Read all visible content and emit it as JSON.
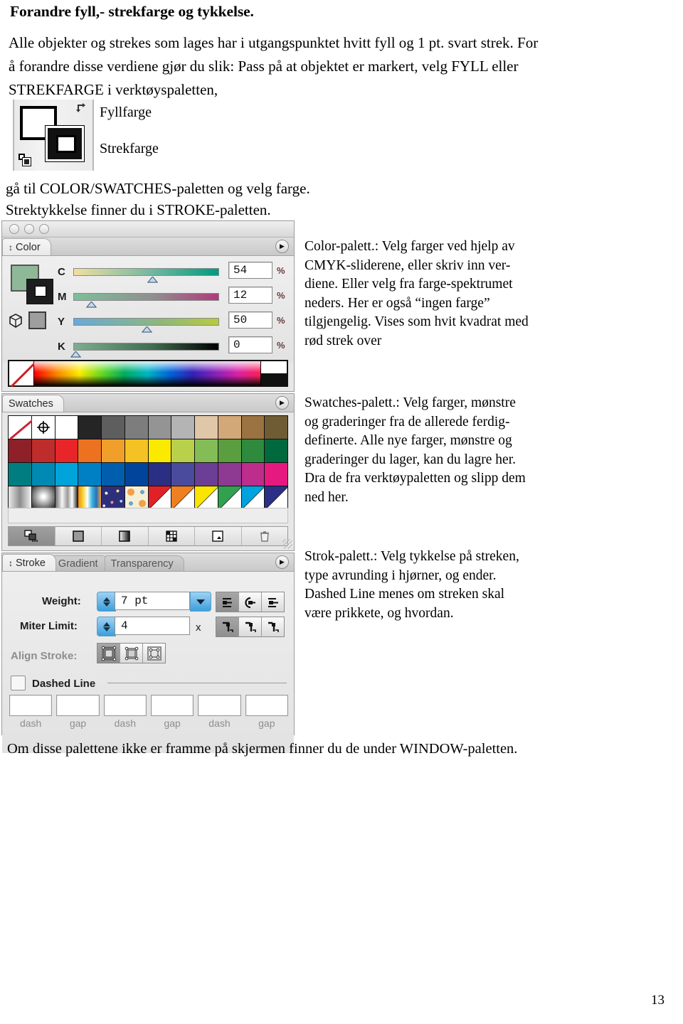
{
  "document": {
    "title": "Forandre fyll,- strekfarge og tykkelse.",
    "intro_lines": [
      "Alle objekter og strekes som lages har i utgangspunktet hvitt fyll og 1 pt. svart strek. For",
      "å forandre disse verdiene gjør du slik: Pass på at objektet er markert, velg FYLL eller",
      "STREKFARGE i verktøyspaletten,"
    ],
    "fill_label": "Fyllfarge",
    "stroke_label": "Strekfarge",
    "palette_lines": [
      "gå til COLOR/SWATCHES-paletten og velg farge.",
      "Strektykkelse finner du i STROKE-paletten."
    ],
    "bottom_note": "Om disse palettene ikke er framme på skjermen finner du de under WINDOW-paletten.",
    "page_number": "13"
  },
  "callouts": {
    "color": [
      "Color-palett.: Velg farger ved hjelp av",
      "CMYK-sliderene, eller skriv inn ver-",
      "diene. Eller velg fra farge-spektrumet",
      "neders. Her er også “ingen farge”",
      "tilgjengelig. Vises som hvit kvadrat med",
      "rød strek over"
    ],
    "swatches": [
      "Swatches-palett.: Velg farger, mønstre",
      "og graderinger fra de allerede ferdig-",
      "definerte. Alle nye farger, mønstre og",
      "graderinger du lager, kan du lagre her.",
      "Dra de fra verktøypaletten og slipp dem",
      "ned her."
    ],
    "stroke": [
      "Strok-palett.: Velg tykkelse på streken,",
      "type avrunding i hjørner, og ender.",
      "Dashed Line menes om streken skal",
      "være prikkete, og hvordan."
    ]
  },
  "color_panel": {
    "tab_label": "Color",
    "fill_color": "#8fb899",
    "stroke_color": "#1d1d1d",
    "channels": [
      {
        "name": "C",
        "value": "54",
        "unit": "%",
        "percent": 54
      },
      {
        "name": "M",
        "value": "12",
        "unit": "%",
        "percent": 12
      },
      {
        "name": "Y",
        "value": "50",
        "unit": "%",
        "percent": 50
      },
      {
        "name": "K",
        "value": "0",
        "unit": "%",
        "percent": 0
      }
    ]
  },
  "swatches_panel": {
    "tab_label": "Swatches",
    "rows": [
      [
        "none",
        "registration",
        "#ffffff",
        "#252525",
        "#5e5e5e",
        "#7d7d7d",
        "#949494",
        "#b4b4b4",
        "#e0c7a8",
        "#d2a878",
        "#9a7340",
        "#6f5c35"
      ],
      [
        "#8d2028",
        "#bf2c2c",
        "#e8262a",
        "#ed7220",
        "#f0a02a",
        "#f4c222",
        "#fbe900",
        "#b9d04a",
        "#84bd55",
        "#5a9e3f",
        "#2e8b3d",
        "#00693e"
      ],
      [
        "#007d81",
        "#0089b3",
        "#00a3da",
        "#0080c4",
        "#005ead",
        "#00459b",
        "#2a2f83",
        "#4b4b9e",
        "#6b3f96",
        "#8e3a92",
        "#bd2d8c",
        "#e6197f"
      ],
      [
        "grad-gray",
        "grad-radial",
        "grad-steel",
        "grad-rainbow",
        "pattern-confetti",
        "pattern-tile",
        "#e02227",
        "#ef7f20",
        "#fbe400",
        "#31a04f",
        "#00a3dd",
        "#2b2f86"
      ]
    ],
    "footer_buttons": [
      "show-all-swatches",
      "solid-color-swatch",
      "gradient-swatch",
      "pattern-swatch",
      "new-swatch",
      "delete-swatch"
    ]
  },
  "stroke_panel": {
    "tabs": [
      {
        "label": "Stroke",
        "active": true
      },
      {
        "label": "Gradient",
        "active": false
      },
      {
        "label": "Transparency",
        "active": false
      }
    ],
    "weight_label": "Weight:",
    "weight_value": "7 pt",
    "miter_label": "Miter Limit:",
    "miter_value": "4",
    "miter_unit": "x",
    "align_label": "Align Stroke:",
    "dashed_label": "Dashed Line",
    "dash_fields": [
      {
        "label": "dash",
        "value": ""
      },
      {
        "label": "gap",
        "value": ""
      },
      {
        "label": "dash",
        "value": ""
      },
      {
        "label": "gap",
        "value": ""
      },
      {
        "label": "dash",
        "value": ""
      },
      {
        "label": "gap",
        "value": ""
      }
    ],
    "cap_buttons": [
      "butt-cap",
      "round-cap",
      "projecting-cap"
    ],
    "join_buttons": [
      "miter-join",
      "round-join",
      "bevel-join"
    ],
    "align_buttons": [
      "align-center",
      "align-inside",
      "align-outside"
    ]
  }
}
